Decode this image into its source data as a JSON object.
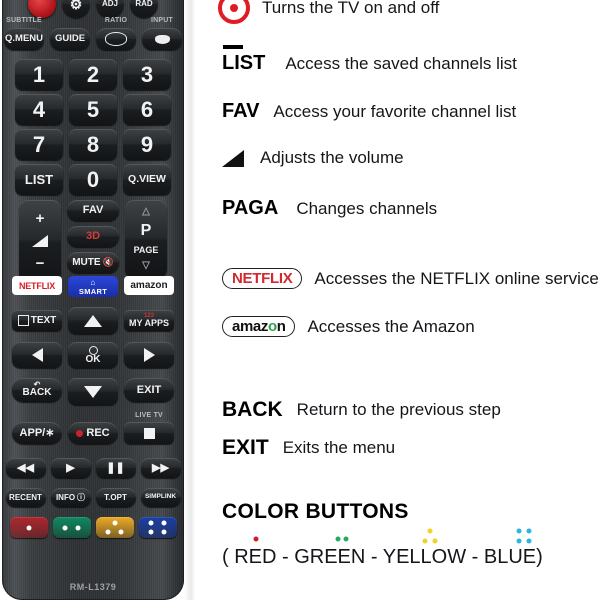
{
  "remote": {
    "model": "RM-L1379",
    "top_row_labels": [
      "SUBTITLE",
      "",
      "RATIO",
      "INPUT"
    ],
    "top_row_buttons": [
      {
        "label": "Q.MENU",
        "name": "q-menu-button"
      },
      {
        "label": "GUIDE",
        "name": "guide-button"
      },
      {
        "label": "",
        "name": "ratio-button"
      },
      {
        "label": "",
        "name": "input-button"
      }
    ],
    "power_label": "POWER",
    "numpad": [
      {
        "label": "1",
        "name": "number-1-button"
      },
      {
        "label": "2",
        "name": "number-2-button"
      },
      {
        "label": "3",
        "name": "number-3-button"
      },
      {
        "label": "4",
        "name": "number-4-button"
      },
      {
        "label": "5",
        "name": "number-5-button"
      },
      {
        "label": "6",
        "name": "number-6-button"
      },
      {
        "label": "7",
        "name": "number-7-button"
      },
      {
        "label": "8",
        "name": "number-8-button"
      },
      {
        "label": "9",
        "name": "number-9-button"
      },
      {
        "label": "LIST",
        "name": "list-button"
      },
      {
        "label": "0",
        "name": "number-0-button"
      },
      {
        "label": "Q.VIEW",
        "name": "q-view-button"
      }
    ],
    "fav_label": "FAV",
    "threed_label": "3D",
    "mute_label": "MUTE",
    "page_label_p": "P",
    "page_label_page": "PAGE",
    "netflix_label": "NETFLIX",
    "smart_label": "SMART",
    "amazon_label": "amazon",
    "text_label": "TEXT",
    "myapps_label": "MY APPS",
    "myapps_top": "123",
    "ok_label": "OK",
    "back_label": "BACK",
    "exit_label": "EXIT",
    "live_tv_label": "LIVE TV",
    "app_star_label": "APP/∗",
    "rec_label": "REC",
    "function_row": [
      {
        "label": "RECENT",
        "name": "recent-button"
      },
      {
        "label": "INFO",
        "name": "info-button"
      },
      {
        "label": "T.OPT",
        "name": "t-opt-button"
      },
      {
        "label": "SIMPLINK",
        "name": "simplink-button"
      }
    ],
    "color_buttons": [
      {
        "name": "red-color-button",
        "color": "#b0262c",
        "dots": 1
      },
      {
        "name": "green-color-button",
        "color": "#0e8a60",
        "dots": 2
      },
      {
        "name": "yellow-color-button",
        "color": "#eeab26",
        "dots": 3
      },
      {
        "name": "blue-color-button",
        "color": "#1a3fa8",
        "dots": 4
      }
    ]
  },
  "legend": {
    "items": [
      {
        "key": "",
        "icon": "power-icon",
        "desc": "Turns the TV on and off"
      },
      {
        "key": "LIST",
        "icon": "list-overline-icon",
        "desc": "Access the saved channels list"
      },
      {
        "key": "FAV",
        "icon": "",
        "desc": "Access your favorite channel list"
      },
      {
        "key": "",
        "icon": "volume-wedge-icon",
        "desc": "Adjusts the volume"
      },
      {
        "key": "PAGA",
        "icon": "",
        "desc": "Changes channels"
      },
      {
        "key": "NETFLIX",
        "icon": "netflix-chip-icon",
        "desc": "Accesses the NETFLIX online service"
      },
      {
        "key": "amazon",
        "icon": "amazon-chip-icon",
        "desc": "Accesses the Amazon"
      },
      {
        "key": "BACK",
        "icon": "",
        "desc": "Return to the previous step"
      },
      {
        "key": "EXIT",
        "icon": "",
        "desc": "Exits the menu"
      }
    ],
    "color_section": {
      "title": "COLOR BUTTONS",
      "caption": "( RED - GREEN - YELLOW - BLUE)",
      "swatches": [
        {
          "name": "red-dots",
          "color": "#cc2027",
          "dots": 1
        },
        {
          "name": "green-dots",
          "color": "#27a85e",
          "dots": 2
        },
        {
          "name": "yellow-dots",
          "color": "#edd528",
          "dots": 3
        },
        {
          "name": "blue-dots",
          "color": "#2bb4e0",
          "dots": 4
        }
      ]
    }
  }
}
